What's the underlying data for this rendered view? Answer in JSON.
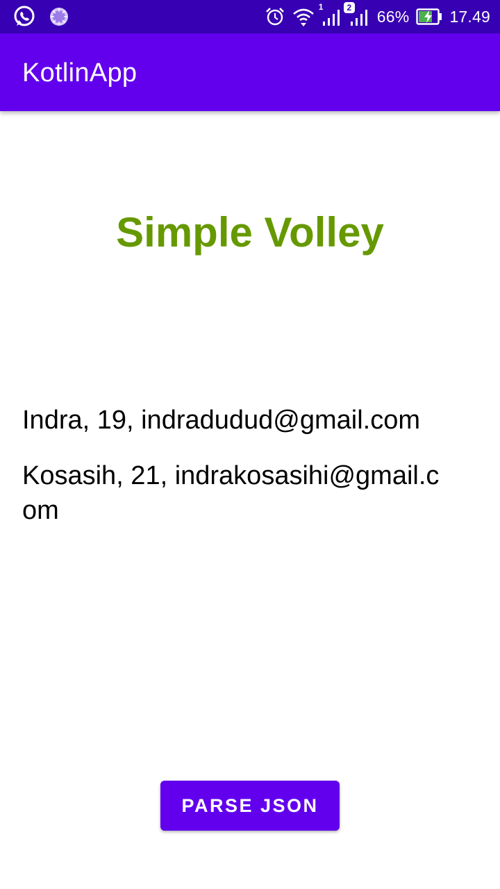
{
  "status_bar": {
    "battery_percent": "66%",
    "time": "17.49",
    "sim1_label": "1",
    "sim2_label": "2",
    "icons": [
      "whatsapp-icon",
      "loading-icon",
      "alarm-icon",
      "wifi-icon",
      "signal-sim1-icon",
      "signal-sim2-icon",
      "battery-charging-icon"
    ],
    "background_color": "#3700b3"
  },
  "app_bar": {
    "title": "KotlinApp",
    "background_color": "#6200ee"
  },
  "main": {
    "heading": "Simple Volley",
    "heading_color": "#669900",
    "results": [
      "Indra, 19, indradudud@gmail.com",
      "Kosasih, 21, indrakosasihi@gmail.com"
    ]
  },
  "actions": {
    "parse_button_label": "PARSE JSON",
    "accent_color": "#6200ee"
  }
}
